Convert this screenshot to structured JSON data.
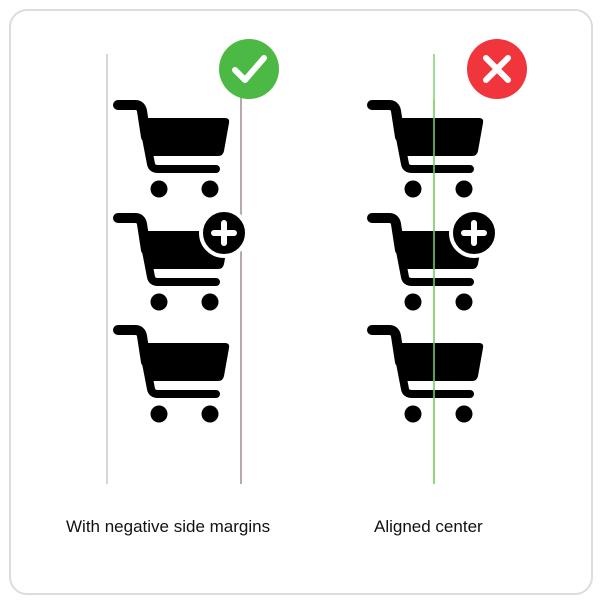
{
  "captions": {
    "left": "With negative side margins",
    "right": "Aligned center"
  },
  "panels": [
    {
      "id": "left",
      "verdict": "correct",
      "badge_icon": "check-icon",
      "badge_color": "#4cb944",
      "guide_color": "#c9c9c9",
      "guide2_color": "#9e8f8f"
    },
    {
      "id": "right",
      "verdict": "incorrect",
      "badge_icon": "x-icon",
      "badge_color": "#f0353d",
      "guide_color": "#7fd36a"
    }
  ],
  "icons": [
    "shopping-cart-icon",
    "add-to-cart-icon",
    "shopping-cart-icon"
  ]
}
